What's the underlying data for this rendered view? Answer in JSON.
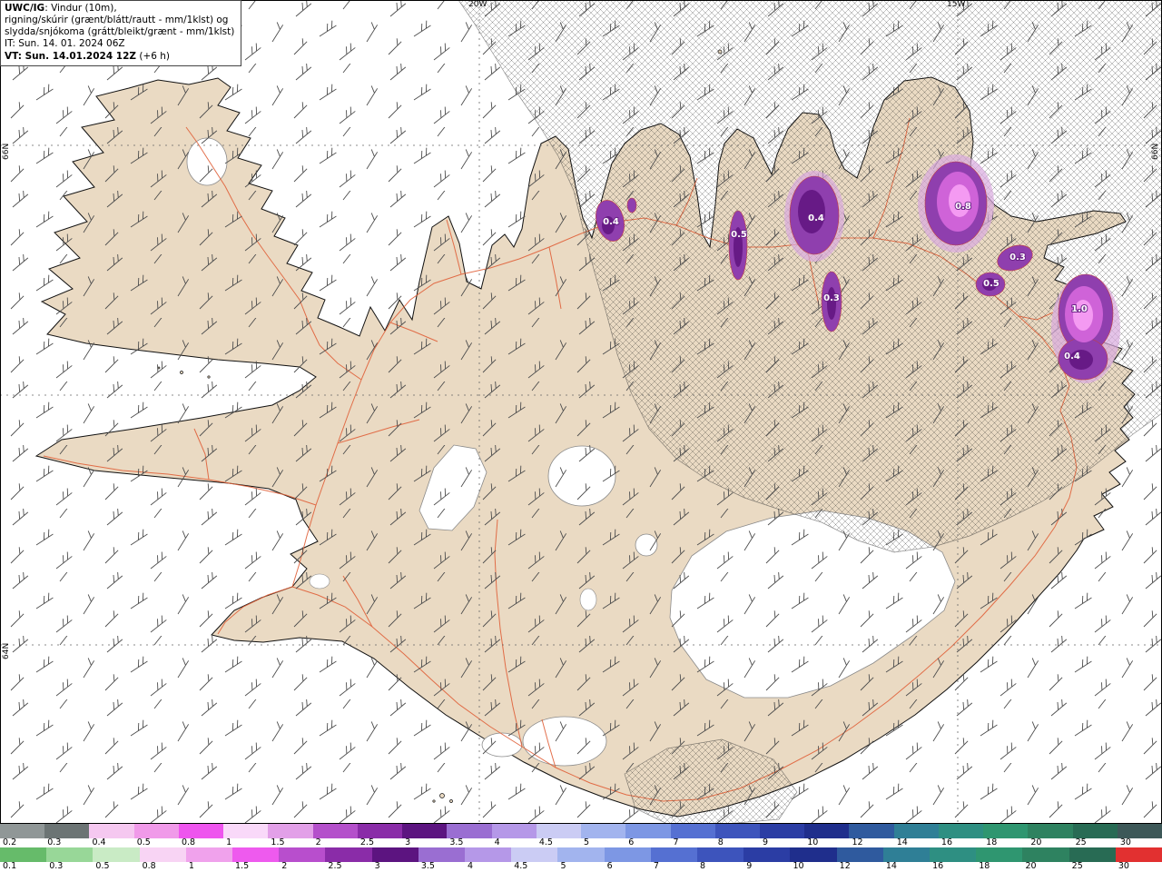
{
  "legend": {
    "model": "UWC/IG",
    "line1_rest": ": Vindur (10m),",
    "line2": "rigning/skúrir (grænt/blátt/rautt - mm/1klst) og",
    "line3": "slydda/snjókoma (grátt/bleikt/grænt - mm/1klst)",
    "line4": "IT: Sun. 14. 01. 2024 06Z",
    "line5_bold": "VT: Sun. 14.01.2024 12Z",
    "line5_rest": " (+6 h)"
  },
  "grid_labels": {
    "lon": [
      {
        "text": "20W"
      },
      {
        "text": "15W"
      }
    ],
    "lat_left": [
      {
        "text": "66N"
      },
      {
        "text": "64N"
      }
    ],
    "lat_right": [
      {
        "text": "66N"
      }
    ]
  },
  "precip_labels": [
    {
      "value": "0.4"
    },
    {
      "value": "0.5"
    },
    {
      "value": "0.4"
    },
    {
      "value": "0.3"
    },
    {
      "value": "0.8"
    },
    {
      "value": "0.3"
    },
    {
      "value": "0.5"
    },
    {
      "value": "1.0"
    },
    {
      "value": "0.4"
    }
  ],
  "palette": {
    "ocean": "#ffffff",
    "land": "#eadac3",
    "road": "#e0613a",
    "precip_halo": "#d9aade",
    "precip_outer": "#8f3fae",
    "precip_darkcore": "#671a86",
    "precip_bright_mid": "#cf63d8",
    "precip_bright_core": "#f49af2"
  },
  "colorbars": {
    "snow": {
      "unit": "mm/1klst",
      "cells": [
        {
          "label": "0.2",
          "color": "#909797"
        },
        {
          "label": "0.3",
          "color": "#6c7474"
        },
        {
          "label": "0.4",
          "color": "#f5c8f0"
        },
        {
          "label": "0.5",
          "color": "#f09ae9"
        },
        {
          "label": "0.8",
          "color": "#ee55ee"
        },
        {
          "label": "1",
          "color": "#f9d9f9"
        },
        {
          "label": "1.5",
          "color": "#e2a0e8"
        },
        {
          "label": "2",
          "color": "#b450cb"
        },
        {
          "label": "2.5",
          "color": "#8a2ca8"
        },
        {
          "label": "3",
          "color": "#5c1480"
        },
        {
          "label": "3.5",
          "color": "#9a6ed2"
        },
        {
          "label": "4",
          "color": "#b598e8"
        },
        {
          "label": "4.5",
          "color": "#cbccf4"
        },
        {
          "label": "5",
          "color": "#a2b4ee"
        },
        {
          "label": "6",
          "color": "#7d97e4"
        },
        {
          "label": "7",
          "color": "#5570d2"
        },
        {
          "label": "8",
          "color": "#3d54bc"
        },
        {
          "label": "9",
          "color": "#2b3da4"
        },
        {
          "label": "10",
          "color": "#1f2e8c"
        },
        {
          "label": "12",
          "color": "#2f5a9e"
        },
        {
          "label": "14",
          "color": "#2f7f96"
        },
        {
          "label": "16",
          "color": "#2e8f82"
        },
        {
          "label": "18",
          "color": "#2f9670"
        },
        {
          "label": "20",
          "color": "#2e8260"
        },
        {
          "label": "25",
          "color": "#286b54"
        },
        {
          "label": "30",
          "color": "#3d5858"
        }
      ]
    },
    "rain": {
      "unit": "mm/1klst",
      "cells": [
        {
          "label": "0.1",
          "color": "#66bb6a"
        },
        {
          "label": "0.3",
          "color": "#98d798"
        },
        {
          "label": "0.5",
          "color": "#c9ebc5"
        },
        {
          "label": "0.8",
          "color": "#f8d4f4"
        },
        {
          "label": "1",
          "color": "#f0a2ec"
        },
        {
          "label": "1.5",
          "color": "#ee5aee"
        },
        {
          "label": "2",
          "color": "#b84ecd"
        },
        {
          "label": "2.5",
          "color": "#8a2ca8"
        },
        {
          "label": "3",
          "color": "#5c1480"
        },
        {
          "label": "3.5",
          "color": "#9a6ed2"
        },
        {
          "label": "4",
          "color": "#b598e8"
        },
        {
          "label": "4.5",
          "color": "#cbccf4"
        },
        {
          "label": "5",
          "color": "#a2b4ee"
        },
        {
          "label": "6",
          "color": "#7d97e4"
        },
        {
          "label": "7",
          "color": "#5570d2"
        },
        {
          "label": "8",
          "color": "#3d54bc"
        },
        {
          "label": "9",
          "color": "#2b3da4"
        },
        {
          "label": "10",
          "color": "#1f2e8c"
        },
        {
          "label": "12",
          "color": "#2f5a9e"
        },
        {
          "label": "14",
          "color": "#2f7f96"
        },
        {
          "label": "16",
          "color": "#2e8f82"
        },
        {
          "label": "18",
          "color": "#2f9670"
        },
        {
          "label": "20",
          "color": "#2e8260"
        },
        {
          "label": "25",
          "color": "#286b54"
        },
        {
          "label": "30",
          "color": "#e23030"
        }
      ]
    }
  }
}
